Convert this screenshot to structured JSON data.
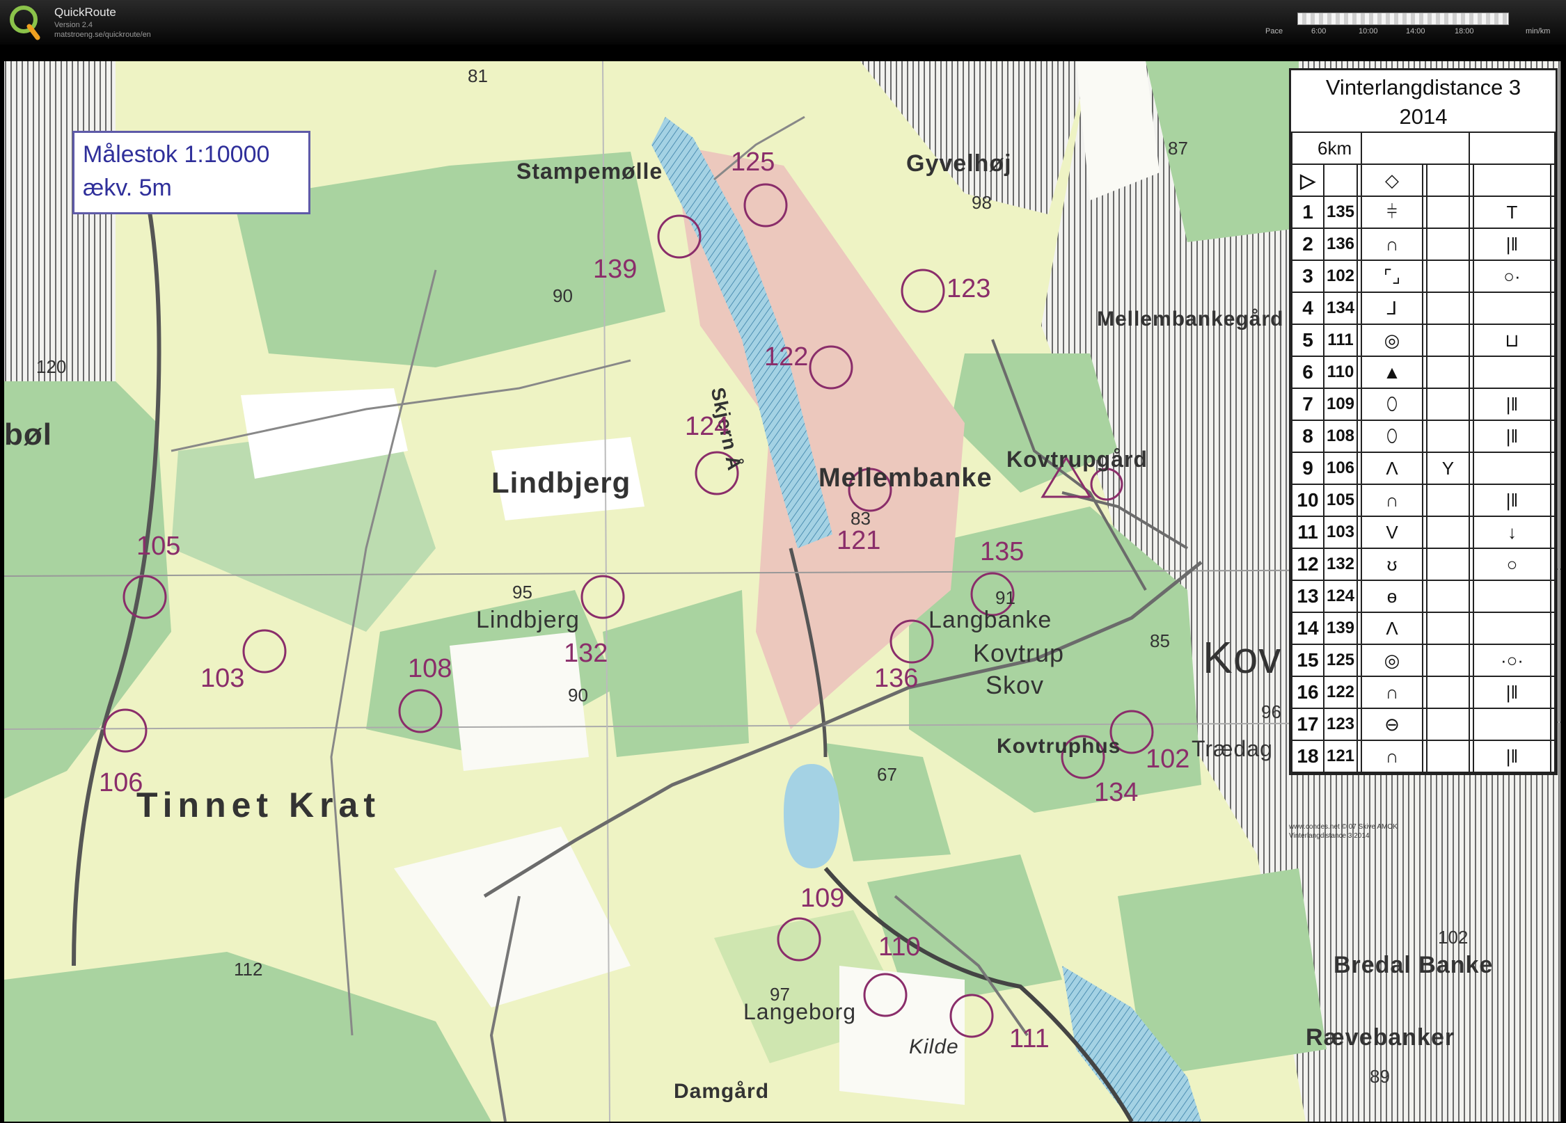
{
  "app": {
    "name": "QuickRoute",
    "version": "Version 2.4",
    "url": "matstroeng.se/quickroute/en",
    "pace_label": "Pace",
    "pace_ticks": [
      "6:00",
      "10:00",
      "14:00",
      "18:00"
    ],
    "pace_unit": "min/km"
  },
  "map": {
    "scale_line1": "Målestok 1:10000",
    "scale_line2": "ækv. 5m",
    "places": {
      "stampemolle": "Stampemølle",
      "gyvelhoj": "Gyvelhøj",
      "mellembankegard": "Mellembankegård",
      "lindbjerg": "Lindbjerg",
      "lindbjerg2": "Lindbjerg",
      "mellembanke": "Mellembanke",
      "kovtrupgard": "Kovtrupgård",
      "langbanke": "Langbanke",
      "kovtrup": "Kovtrup",
      "skov": "Skov",
      "kovtruphus": "Kovtruphus",
      "traedag": "Trædag",
      "tinnet_krat": "Tinnet Krat",
      "langeborg": "Langeborg",
      "kilde": "Kilde",
      "damgard": "Damgård",
      "bredal_banke": "Bredal Banke",
      "raevebanker": "Rævebanker",
      "bol": "bøl",
      "skjern_a": "Skjern Å",
      "kov": "Kov"
    },
    "heights": [
      "81",
      "98",
      "87",
      "90",
      "120",
      "83",
      "95",
      "91",
      "85",
      "90",
      "67",
      "112",
      "97",
      "102",
      "89",
      "96"
    ],
    "controls": [
      "125",
      "139",
      "123",
      "122",
      "124",
      "121",
      "135",
      "105",
      "132",
      "103",
      "108",
      "136",
      "106",
      "102",
      "134",
      "109",
      "110",
      "111"
    ]
  },
  "sheet": {
    "title_line1": "Vinterlangdistance 3",
    "title_line2": "2014",
    "distance": "6km",
    "start_symbol": "▷",
    "start_feature": "◇",
    "rows": [
      {
        "num": "1",
        "code": "135",
        "feature": "⫩",
        "detail": "",
        "appearance": "T"
      },
      {
        "num": "2",
        "code": "136",
        "feature": "∩",
        "detail": "",
        "appearance": "|‖"
      },
      {
        "num": "3",
        "code": "102",
        "feature": "⌜⌟",
        "detail": "",
        "appearance": "○·"
      },
      {
        "num": "4",
        "code": "134",
        "feature": "⅃",
        "detail": "",
        "appearance": ""
      },
      {
        "num": "5",
        "code": "111",
        "feature": "◎",
        "detail": "",
        "appearance": "⊔"
      },
      {
        "num": "6",
        "code": "110",
        "feature": "▲",
        "detail": "",
        "appearance": ""
      },
      {
        "num": "7",
        "code": "109",
        "feature": "⬯",
        "detail": "",
        "appearance": "|‖"
      },
      {
        "num": "8",
        "code": "108",
        "feature": "⬯",
        "detail": "",
        "appearance": "|‖"
      },
      {
        "num": "9",
        "code": "106",
        "feature": "Λ",
        "detail": "Y",
        "appearance": ""
      },
      {
        "num": "10",
        "code": "105",
        "feature": "∩",
        "detail": "",
        "appearance": "|‖"
      },
      {
        "num": "11",
        "code": "103",
        "feature": "V",
        "detail": "",
        "appearance": "↓"
      },
      {
        "num": "12",
        "code": "132",
        "feature": "ʊ",
        "detail": "",
        "appearance": "○"
      },
      {
        "num": "13",
        "code": "124",
        "feature": "ө",
        "detail": "",
        "appearance": ""
      },
      {
        "num": "14",
        "code": "139",
        "feature": "Λ",
        "detail": "",
        "appearance": ""
      },
      {
        "num": "15",
        "code": "125",
        "feature": "◎",
        "detail": "",
        "appearance": "·○·"
      },
      {
        "num": "16",
        "code": "122",
        "feature": "∩",
        "detail": "",
        "appearance": "|‖"
      },
      {
        "num": "17",
        "code": "123",
        "feature": "⊖",
        "detail": "",
        "appearance": ""
      },
      {
        "num": "18",
        "code": "121",
        "feature": "∩",
        "detail": "",
        "appearance": "|‖"
      }
    ],
    "credit_line1": "www.condes.net © 07 Skive AMOK",
    "credit_line2": "Vinterlangdistance 3 2014"
  },
  "colors": {
    "forest_green": "#a9d3a0",
    "light_green": "#cfe6b0",
    "open_yellow": "#eef3c4",
    "marsh_pink": "#ecc8bd",
    "water_blue": "#a4d2e4",
    "control_purple": "#8a2d6a"
  }
}
